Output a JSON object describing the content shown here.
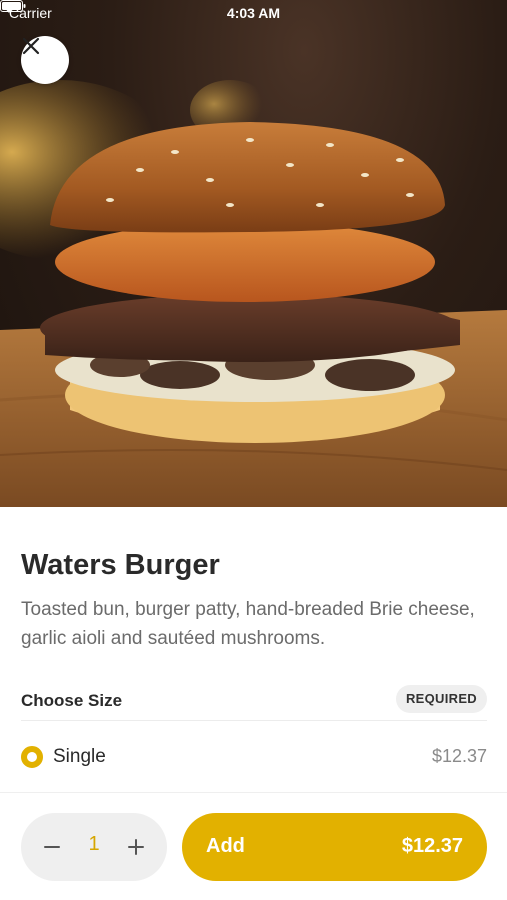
{
  "status_bar": {
    "carrier": "Carrier",
    "time": "4:03 AM"
  },
  "hero": {
    "image_name": "burger-photo"
  },
  "item": {
    "title": "Waters Burger",
    "description": "Toasted bun, burger patty, hand-breaded Brie cheese, garlic aioli and sautéed mushrooms."
  },
  "size_section": {
    "title": "Choose Size",
    "badge": "REQUIRED",
    "options": [
      {
        "label": "Single",
        "price": "$12.37",
        "selected": true
      }
    ]
  },
  "cart": {
    "quantity": "1",
    "add_label": "Add",
    "total": "$12.37"
  },
  "colors": {
    "accent": "#e2b100",
    "quantity_text": "#d6a600"
  },
  "icons": [
    "wifi-icon",
    "battery-icon",
    "close-icon",
    "minus-icon",
    "plus-icon"
  ]
}
